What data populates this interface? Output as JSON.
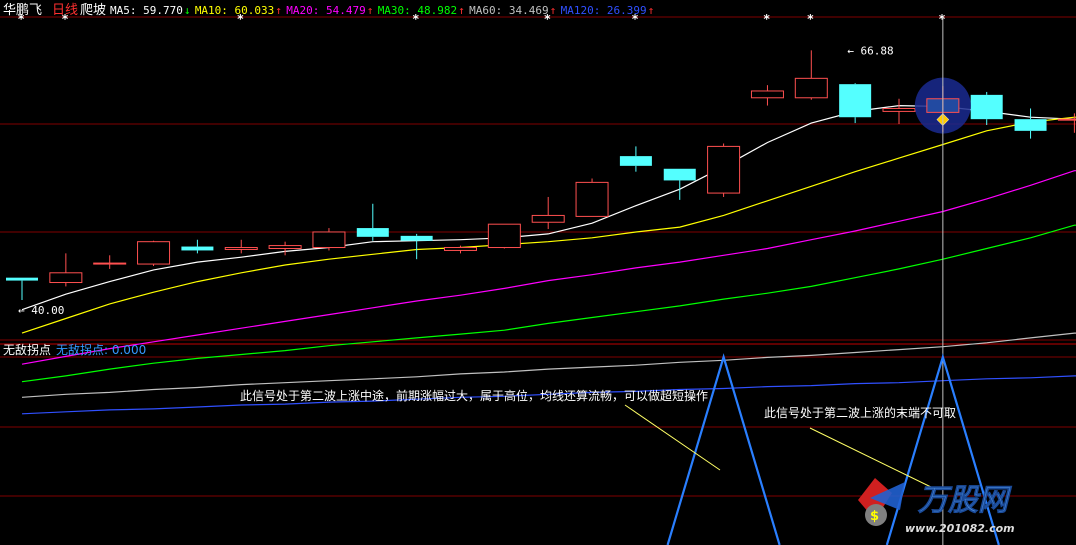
{
  "header": {
    "stock_name": "华鹏飞",
    "period": "日线",
    "indicator_name": "爬坡",
    "ma_items": [
      {
        "label": "MA5: 59.770",
        "arrow": "↓",
        "color": "#ffffff"
      },
      {
        "label": "MA10: 60.033",
        "arrow": "↑",
        "color": "#ffff00"
      },
      {
        "label": "MA20: 54.479",
        "arrow": "↑",
        "color": "#ff00ff"
      },
      {
        "label": "MA30: 48.982",
        "arrow": "↑",
        "color": "#00ff00"
      },
      {
        "label": "MA60: 34.469",
        "arrow": "↑",
        "color": "#c0c0c0"
      },
      {
        "label": "MA120: 26.399",
        "arrow": "↑",
        "color": "#3050ff"
      }
    ]
  },
  "colors": {
    "up_candle": "#ff5050",
    "down_candle": "#54ffff",
    "grid": "#800000",
    "ma5": "#ffffff",
    "ma10": "#ffff00",
    "ma20": "#ff00ff",
    "ma30": "#00ff00",
    "ma60": "#c0c0c0",
    "ma120": "#3050ff",
    "signal_line": "#2a7fff",
    "annotation_text": "#ffffff",
    "leader_line": "#ffff66",
    "sub_label": "#3399ff"
  },
  "chart_data": [
    {
      "type": "candlestick",
      "title": "",
      "ylim": [
        37.5,
        70
      ],
      "candles": [
        {
          "o": 43.5,
          "h": 43.5,
          "l": 41.2,
          "c": 43.2
        },
        {
          "o": 43.0,
          "h": 46.0,
          "l": 42.6,
          "c": 44.0
        },
        {
          "o": 45.0,
          "h": 45.8,
          "l": 44.4,
          "c": 45.0
        },
        {
          "o": 44.9,
          "h": 47.3,
          "l": 44.7,
          "c": 47.2
        },
        {
          "o": 46.7,
          "h": 47.4,
          "l": 46.0,
          "c": 46.3
        },
        {
          "o": 46.4,
          "h": 47.4,
          "l": 46.0,
          "c": 46.6
        },
        {
          "o": 46.5,
          "h": 47.2,
          "l": 45.8,
          "c": 46.8
        },
        {
          "o": 46.6,
          "h": 48.6,
          "l": 46.3,
          "c": 48.2
        },
        {
          "o": 48.6,
          "h": 51.1,
          "l": 47.3,
          "c": 47.7
        },
        {
          "o": 47.8,
          "h": 48.0,
          "l": 45.4,
          "c": 47.3
        },
        {
          "o": 46.3,
          "h": 46.8,
          "l": 46.0,
          "c": 46.6
        },
        {
          "o": 46.6,
          "h": 49.0,
          "l": 46.5,
          "c": 49.0
        },
        {
          "o": 49.2,
          "h": 51.8,
          "l": 48.5,
          "c": 49.9
        },
        {
          "o": 49.8,
          "h": 53.7,
          "l": 49.8,
          "c": 53.3
        },
        {
          "o": 56.0,
          "h": 57.0,
          "l": 54.4,
          "c": 55.0
        },
        {
          "o": 54.7,
          "h": 54.7,
          "l": 51.5,
          "c": 53.5
        },
        {
          "o": 52.2,
          "h": 57.3,
          "l": 51.8,
          "c": 57.0
        },
        {
          "o": 62.0,
          "h": 63.3,
          "l": 61.2,
          "c": 62.7
        },
        {
          "o": 62.0,
          "h": 66.88,
          "l": 61.8,
          "c": 64.0
        },
        {
          "o": 63.4,
          "h": 63.5,
          "l": 59.4,
          "c": 60.0
        },
        {
          "o": 60.6,
          "h": 61.9,
          "l": 59.3,
          "c": 60.9
        },
        {
          "o": 61.9,
          "h": 63.2,
          "l": 58.5,
          "c": 60.5
        },
        {
          "o": 62.3,
          "h": 62.6,
          "l": 59.2,
          "c": 59.8
        },
        {
          "o": 59.8,
          "h": 60.9,
          "l": 57.8,
          "c": 58.6
        },
        {
          "o": 59.8,
          "h": 60.4,
          "l": 58.4,
          "c": 59.8
        }
      ],
      "series": [
        {
          "name": "MA5",
          "values": [
            40.2,
            41.8,
            43.1,
            44.3,
            45.1,
            45.6,
            46.2,
            46.6,
            47.2,
            47.3,
            47.4,
            47.6,
            48.0,
            49.1,
            50.9,
            52.6,
            54.9,
            57.4,
            59.4,
            60.6,
            61.2,
            61.1,
            60.6,
            60.0,
            59.8
          ]
        },
        {
          "name": "MA10",
          "values": [
            37.8,
            39.3,
            40.8,
            42.0,
            43.1,
            44.0,
            44.8,
            45.4,
            45.9,
            46.4,
            46.6,
            46.9,
            47.2,
            47.6,
            48.2,
            48.7,
            49.9,
            51.4,
            52.9,
            54.4,
            55.8,
            57.2,
            58.6,
            59.5,
            60.0
          ]
        },
        {
          "name": "MA20",
          "values": [
            34.6,
            35.4,
            36.2,
            36.9,
            37.6,
            38.3,
            39.0,
            39.7,
            40.4,
            41.1,
            41.7,
            42.4,
            43.2,
            43.8,
            44.5,
            45.1,
            45.8,
            46.5,
            47.4,
            48.3,
            49.3,
            50.3,
            51.6,
            53.0,
            54.5
          ]
        },
        {
          "name": "MA30",
          "values": [
            32.8,
            33.4,
            34.1,
            34.7,
            35.2,
            35.6,
            36.0,
            36.5,
            36.9,
            37.3,
            37.7,
            38.1,
            38.8,
            39.4,
            40.0,
            40.6,
            41.3,
            41.9,
            42.6,
            43.5,
            44.4,
            45.4,
            46.5,
            47.6,
            48.9
          ]
        },
        {
          "name": "MA60",
          "values": [
            31.2,
            31.5,
            31.7,
            32.0,
            32.2,
            32.5,
            32.7,
            32.9,
            33.1,
            33.3,
            33.6,
            33.8,
            34.1,
            34.3,
            34.5,
            34.8,
            35.0,
            35.3,
            35.5,
            35.8,
            36.1,
            36.4,
            36.8,
            37.3,
            37.8
          ]
        },
        {
          "name": "MA120",
          "values": [
            29.5,
            29.7,
            29.9,
            30.0,
            30.2,
            30.4,
            30.5,
            30.7,
            30.8,
            31.0,
            31.2,
            31.3,
            31.5,
            31.7,
            31.8,
            32.0,
            32.1,
            32.3,
            32.4,
            32.6,
            32.7,
            32.9,
            33.1,
            33.2,
            33.4
          ]
        }
      ],
      "markers": [
        {
          "index": 0,
          "label": "40.00"
        },
        {
          "index": 18,
          "label": "66.88"
        }
      ],
      "star_marks": [
        0,
        1,
        5,
        9,
        12,
        14,
        17,
        18,
        21
      ],
      "cursor_index": 21,
      "highlight_index": 21
    },
    {
      "type": "line",
      "title": "无敌拐点",
      "value_label": "无敌拐点: 0.000",
      "signal_spikes": [
        16,
        21
      ],
      "annotations": [
        {
          "text": "此信号处于第二波上涨中途，前期涨幅过大，属于高位，均线还算流畅，可以做超短操作",
          "target_spike": 0
        },
        {
          "text": "此信号处于第二波上涨的末端不可取",
          "target_spike": 1
        }
      ]
    }
  ],
  "watermark": {
    "text": "万股网",
    "url": "www.201082.com"
  }
}
